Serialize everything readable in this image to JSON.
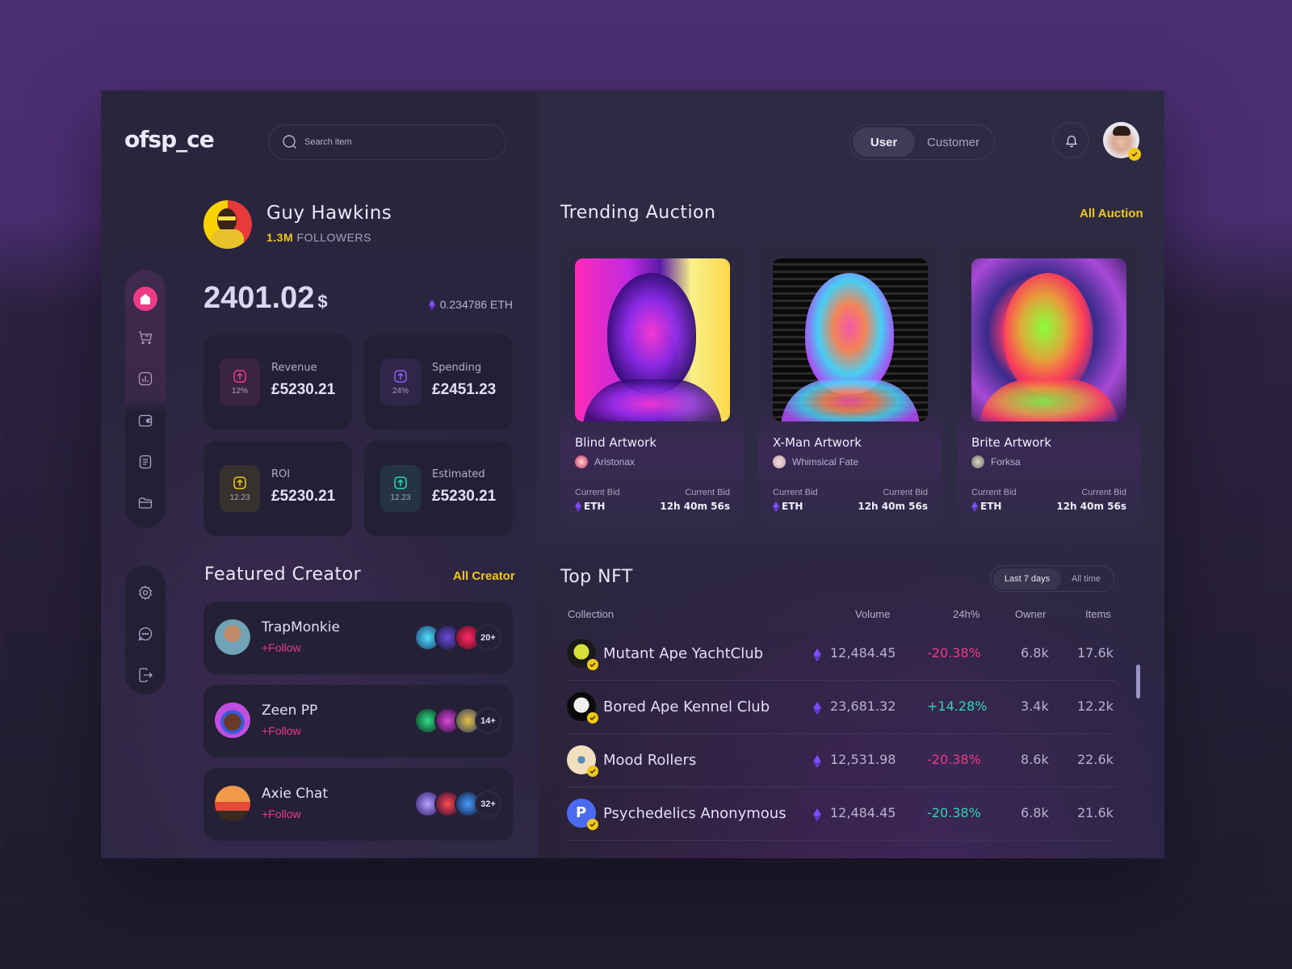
{
  "app": {
    "logo": "ofsp_ce"
  },
  "search": {
    "placeholder": "Search item"
  },
  "sidebar": {
    "top_items": [
      {
        "name": "home",
        "icon": "home-icon",
        "active": true
      },
      {
        "name": "cart",
        "icon": "cart-icon"
      },
      {
        "name": "analytics",
        "icon": "chart-icon"
      },
      {
        "name": "wallet",
        "icon": "wallet-icon"
      },
      {
        "name": "documents",
        "icon": "document-icon"
      },
      {
        "name": "folder",
        "icon": "folder-icon"
      }
    ],
    "bottom_items": [
      {
        "name": "settings",
        "icon": "gear-icon"
      },
      {
        "name": "messages",
        "icon": "chat-icon"
      },
      {
        "name": "logout",
        "icon": "logout-icon"
      }
    ]
  },
  "profile": {
    "name": "Guy Hawkins",
    "followers_count": "1.3M",
    "followers_label": "FOLLOWERS",
    "balance": "2401.02",
    "balance_currency": "$",
    "eth_balance": "0.234786 ETH"
  },
  "stats": [
    {
      "label": "Revenue",
      "value": "£5230.21",
      "badge": "12%",
      "color": "#ee3b86",
      "bg": "#3a2440"
    },
    {
      "label": "Spending",
      "value": "£2451.23",
      "badge": "24%",
      "color": "#8a5cf6",
      "bg": "#30264a"
    },
    {
      "label": "ROI",
      "value": "£5230.21",
      "badge": "12.23",
      "color": "#f2c816",
      "bg": "#36302f"
    },
    {
      "label": "Estimated",
      "value": "£5230.21",
      "badge": "12.23",
      "color": "#2fd6b0",
      "bg": "#243443"
    }
  ],
  "featured": {
    "title": "Featured Creator",
    "link": "All Creator",
    "creators": [
      {
        "name": "TrapMonkie",
        "follow": "+Follow",
        "count": "20+"
      },
      {
        "name": "Zeen PP",
        "follow": "+Follow",
        "count": "14+"
      },
      {
        "name": "Axie Chat",
        "follow": "+Follow",
        "count": "32+"
      }
    ]
  },
  "header": {
    "roles": [
      "User",
      "Customer"
    ],
    "active_role": "User"
  },
  "trending": {
    "title": "Trending Auction",
    "link": "All Auction",
    "items": [
      {
        "title": "Blind Artwork",
        "author": "Aristonax",
        "bid_label": "Current Bid",
        "bid_value": "ETH",
        "time_label": "Current Bid",
        "time_value": "12h 40m 56s"
      },
      {
        "title": "X-Man Artwork",
        "author": "Whimsical Fate",
        "bid_label": "Current Bid",
        "bid_value": "ETH",
        "time_label": "Current Bid",
        "time_value": "12h 40m 56s"
      },
      {
        "title": "Brite Artwork",
        "author": "Forksa",
        "bid_label": "Current Bid",
        "bid_value": "ETH",
        "time_label": "Current Bid",
        "time_value": "12h 40m 56s"
      }
    ]
  },
  "top_nft": {
    "title": "Top NFT",
    "periods": [
      "Last 7 days",
      "All time"
    ],
    "active_period": "Last 7 days",
    "columns": [
      "Collection",
      "Volume",
      "24h%",
      "Owner",
      "Items"
    ],
    "rows": [
      {
        "name": "Mutant Ape YachtClub",
        "volume": "12,484.45",
        "change": "-20.38%",
        "change_color": "#ee3b86",
        "owner": "6.8k",
        "items": "17.6k"
      },
      {
        "name": "Bored Ape Kennel Club",
        "volume": "23,681.32",
        "change": "+14.28%",
        "change_color": "#2fd6b0",
        "owner": "3.4k",
        "items": "12.2k"
      },
      {
        "name": "Mood Rollers",
        "volume": "12,531.98",
        "change": "-20.38%",
        "change_color": "#ee3b86",
        "owner": "8.6k",
        "items": "22.6k"
      },
      {
        "name": "Psychedelics Anonymous",
        "volume": "12,484.45",
        "change": "-20.38%",
        "change_color": "#2fd6b0",
        "owner": "6.8k",
        "items": "21.6k"
      }
    ]
  },
  "colors": {
    "accent_pink": "#ee3b86",
    "accent_yellow": "#f2c816",
    "accent_purple": "#8a5cf6",
    "accent_teal": "#2fd6b0"
  }
}
